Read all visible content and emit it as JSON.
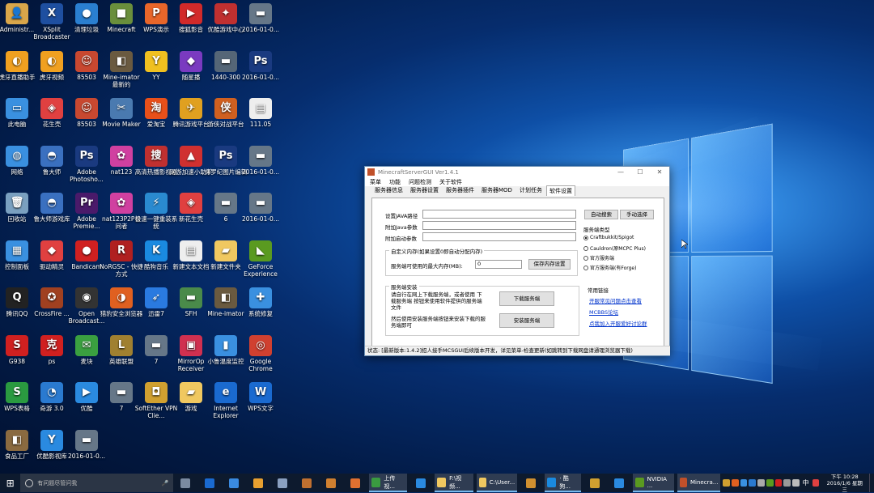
{
  "desktop": {
    "icons": [
      {
        "label": "Administr...",
        "glyph": "👤",
        "color": "#d9a64a"
      },
      {
        "label": "XSplit Broadcaster",
        "glyph": "X",
        "color": "#1e4fa0"
      },
      {
        "label": "清理垃圾",
        "glyph": "●",
        "color": "#2a7fd0"
      },
      {
        "label": "Minecraft",
        "glyph": "■",
        "color": "#6a8f3c"
      },
      {
        "label": "WPS演示",
        "glyph": "P",
        "color": "#e8662a"
      },
      {
        "label": "搜狐影音",
        "glyph": "▶",
        "color": "#d22a2a"
      },
      {
        "label": "优酷游戏中心",
        "glyph": "✦",
        "color": "#c03030"
      },
      {
        "label": "2016-01-0...",
        "glyph": "▬",
        "color": "#667788"
      },
      {
        "label": "虎牙直播助手",
        "glyph": "◐",
        "color": "#f0a020"
      },
      {
        "label": "虎牙视频",
        "glyph": "◐",
        "color": "#f0a020"
      },
      {
        "label": "85503",
        "glyph": "☺",
        "color": "#c84830"
      },
      {
        "label": "Mine-imator 最新的",
        "glyph": "◧",
        "color": "#6a5a40"
      },
      {
        "label": "YY",
        "glyph": "Y",
        "color": "#f0c020"
      },
      {
        "label": "随星播",
        "glyph": "◆",
        "color": "#7a3ac0"
      },
      {
        "label": "1440-300",
        "glyph": "▬",
        "color": "#556677"
      },
      {
        "label": "2016-01-0...",
        "glyph": "Ps",
        "color": "#1a3a80"
      },
      {
        "label": "此电脑",
        "glyph": "▭",
        "color": "#3a90e0"
      },
      {
        "label": "花生壳",
        "glyph": "◈",
        "color": "#e04040"
      },
      {
        "label": "85503",
        "glyph": "☺",
        "color": "#c84830"
      },
      {
        "label": "Movie Maker",
        "glyph": "✂",
        "color": "#4a7ab0"
      },
      {
        "label": "爱淘宝",
        "glyph": "淘",
        "color": "#e8501a"
      },
      {
        "label": "腾讯游戏平台",
        "glyph": "✈",
        "color": "#e0a020"
      },
      {
        "label": "游侠对战平台",
        "glyph": "侠",
        "color": "#d06020"
      },
      {
        "label": "111.05",
        "glyph": "▤",
        "color": "#eeeeee"
      },
      {
        "label": "网络",
        "glyph": "◍",
        "color": "#3a90e0"
      },
      {
        "label": "鲁大师",
        "glyph": "◓",
        "color": "#3a70c0"
      },
      {
        "label": "Adobe Photosho...",
        "glyph": "Ps",
        "color": "#1a3a80"
      },
      {
        "label": "nat123",
        "glyph": "✿",
        "color": "#d040a0"
      },
      {
        "label": "高清热播影视剧",
        "glyph": "搜",
        "color": "#c03030"
      },
      {
        "label": "网游加速小助手",
        "glyph": "▲",
        "color": "#d03030"
      },
      {
        "label": "侏罗纪图片编辑",
        "glyph": "Ps",
        "color": "#1a3a80"
      },
      {
        "label": "2016-01-0...",
        "glyph": "▬",
        "color": "#667788"
      },
      {
        "label": "回收站",
        "glyph": "🗑",
        "color": "#7aa0c0"
      },
      {
        "label": "鲁大师游戏库",
        "glyph": "◓",
        "color": "#3a70c0"
      },
      {
        "label": "Adobe Premie...",
        "glyph": "Pr",
        "color": "#4a1a6a"
      },
      {
        "label": "nat123P2P访问者",
        "glyph": "✿",
        "color": "#d040a0"
      },
      {
        "label": "极速一键重装系统",
        "glyph": "⚡",
        "color": "#2a8ad0"
      },
      {
        "label": "新花生壳",
        "glyph": "◈",
        "color": "#e04040"
      },
      {
        "label": "6",
        "glyph": "▬",
        "color": "#667788"
      },
      {
        "label": "2016-01-0...",
        "glyph": "▬",
        "color": "#667788"
      },
      {
        "label": "控制面板",
        "glyph": "▦",
        "color": "#3a90e0"
      },
      {
        "label": "驱动精灵",
        "glyph": "◆",
        "color": "#e04040"
      },
      {
        "label": "Bandicam",
        "glyph": "●",
        "color": "#d02020"
      },
      {
        "label": "NoRGSC - 快捷方式",
        "glyph": "R",
        "color": "#b02020"
      },
      {
        "label": "酷狗音乐",
        "glyph": "K",
        "color": "#1a8ae0"
      },
      {
        "label": "新建文本文档",
        "glyph": "▤",
        "color": "#eeeeee"
      },
      {
        "label": "新建文件夹",
        "glyph": "▰",
        "color": "#f0c860"
      },
      {
        "label": "GeForce Experience",
        "glyph": "◣",
        "color": "#5a9a20"
      },
      {
        "label": "腾讯QQ",
        "glyph": "Q",
        "color": "#222222"
      },
      {
        "label": "CrossFire ...",
        "glyph": "✪",
        "color": "#a04020"
      },
      {
        "label": "Open Broadcast...",
        "glyph": "◉",
        "color": "#333333"
      },
      {
        "label": "猎豹安全浏览器",
        "glyph": "◑",
        "color": "#e06020"
      },
      {
        "label": "迅雷7",
        "glyph": "➶",
        "color": "#2a7ae0"
      },
      {
        "label": "SFH",
        "glyph": "▬",
        "color": "#4a8a4a"
      },
      {
        "label": "Mine-imator",
        "glyph": "◧",
        "color": "#6a5a40"
      },
      {
        "label": "系统修复",
        "glyph": "✚",
        "color": "#3a90e0"
      },
      {
        "label": "G938",
        "glyph": "S",
        "color": "#d02020"
      },
      {
        "label": "ps",
        "glyph": "克",
        "color": "#d02020"
      },
      {
        "label": "麦块",
        "glyph": "✉",
        "color": "#3aa040"
      },
      {
        "label": "英雄联盟",
        "glyph": "L",
        "color": "#a08030"
      },
      {
        "label": "7",
        "glyph": "▬",
        "color": "#667788"
      },
      {
        "label": "MirrorOp Receiver",
        "glyph": "▣",
        "color": "#d03050"
      },
      {
        "label": "小鲁温度监控",
        "glyph": "▮",
        "color": "#3a90e0"
      },
      {
        "label": "Google Chrome",
        "glyph": "◎",
        "color": "#d04030"
      },
      {
        "label": "WPS表格",
        "glyph": "S",
        "color": "#2a9a40"
      },
      {
        "label": "奇游 3.0",
        "glyph": "◔",
        "color": "#2a7ad0"
      },
      {
        "label": "优酷",
        "glyph": "▶",
        "color": "#2a8ae0"
      },
      {
        "label": "7",
        "glyph": "▬",
        "color": "#667788"
      },
      {
        "label": "SoftEther VPN Clie...",
        "glyph": "◘",
        "color": "#d0a030"
      },
      {
        "label": "游戏",
        "glyph": "▰",
        "color": "#f0c860"
      },
      {
        "label": "Internet Explorer",
        "glyph": "e",
        "color": "#1a6ad0"
      },
      {
        "label": "WPS文字",
        "glyph": "W",
        "color": "#1a6ad0"
      },
      {
        "label": "食品工厂",
        "glyph": "◧",
        "color": "#8a6a40"
      },
      {
        "label": "优酷影视库",
        "glyph": "Y",
        "color": "#2a8ae0"
      },
      {
        "label": "2016-01-0...",
        "glyph": "▬",
        "color": "#667788"
      }
    ]
  },
  "window": {
    "title": "MinecraftServerGUI Ver1.4.1",
    "menu": [
      "菜单",
      "功能",
      "问题检测",
      "关于软件"
    ],
    "tabs": [
      "服务器信息",
      "服务器设置",
      "服务器插件",
      "服务器MOD",
      "计划任务",
      "软件设置"
    ],
    "active_tab": "软件设置",
    "java_path_label": "设置JAVA路径",
    "java_path_value": "",
    "java_args_label": "附加Java参数",
    "java_args_value": "",
    "start_args_label": "附加启动参数",
    "start_args_value": "",
    "auto_search_button": "自动搜索",
    "manual_select_button": "手动选择",
    "memory_group_title": "自定义内存(如果设置0即自动分配内存)",
    "max_memory_label": "服务端可使用的最大内存(MB):",
    "max_memory_value": "0",
    "save_memory_button": "保存内存设置",
    "server_type_title": "服务端类型",
    "server_types": [
      {
        "label": "Craftbukkit/Spigot",
        "selected": true
      },
      {
        "label": "Cauldron(原MCPC Plus)",
        "selected": false
      },
      {
        "label": "官方服务端",
        "selected": false
      },
      {
        "label": "官方服务端(有Forge)",
        "selected": false
      }
    ],
    "install_group_title": "服务端安装",
    "install_text1": "请自行在网上下载服务端，或者使用 下载服务端 按钮来使用软件提供的服务端文件",
    "download_button": "下载服务端",
    "install_text2": "然后使用安装服务端按钮来安装下载的服务端即可",
    "install_button": "安装服务端",
    "links_title": "常用链接",
    "links": [
      "开服常见问题点击查看",
      "MCBBS论坛",
      "点我加入开服爱好讨论群"
    ],
    "status": "状态: [最新版本:1.4.2]招人接手MCSGUI后续版本开发，详见菜单-检查更新(如跳转到下载网盘请通理浏览器下载)"
  },
  "taskbar": {
    "search_placeholder": "有问题尽管问我",
    "apps": [
      {
        "label": "",
        "color": "#7a8aa0"
      },
      {
        "label": "",
        "color": "#1a6ad0"
      },
      {
        "label": "",
        "color": "#3a8ae0"
      },
      {
        "label": "",
        "color": "#e8a030"
      },
      {
        "label": "",
        "color": "#8aa0c0"
      },
      {
        "label": "",
        "color": "#c07030"
      },
      {
        "label": "",
        "color": "#d08030"
      },
      {
        "label": "",
        "color": "#e07030"
      },
      {
        "label": "上传视...",
        "color": "#3a9a40",
        "active": true
      },
      {
        "label": "",
        "color": "#2a8ae0"
      },
      {
        "label": "F:\\视频...",
        "color": "#f0c860",
        "active": true
      },
      {
        "label": "C:\\User...",
        "color": "#f0c860",
        "active": true
      },
      {
        "label": "",
        "color": "#d09030"
      },
      {
        "label": "· 酷狗...",
        "color": "#1a8ae0",
        "active": true
      },
      {
        "label": "",
        "color": "#d0a030"
      },
      {
        "label": "",
        "color": "#2a8ae0"
      },
      {
        "label": "NVIDIA ...",
        "color": "#5a9a20",
        "active": true
      },
      {
        "label": "Minecra...",
        "color": "#c0502a",
        "active": true
      }
    ],
    "tray_ime": "中",
    "clock_time": "下午 10:28",
    "clock_date": "2016/1/6 星期三"
  }
}
